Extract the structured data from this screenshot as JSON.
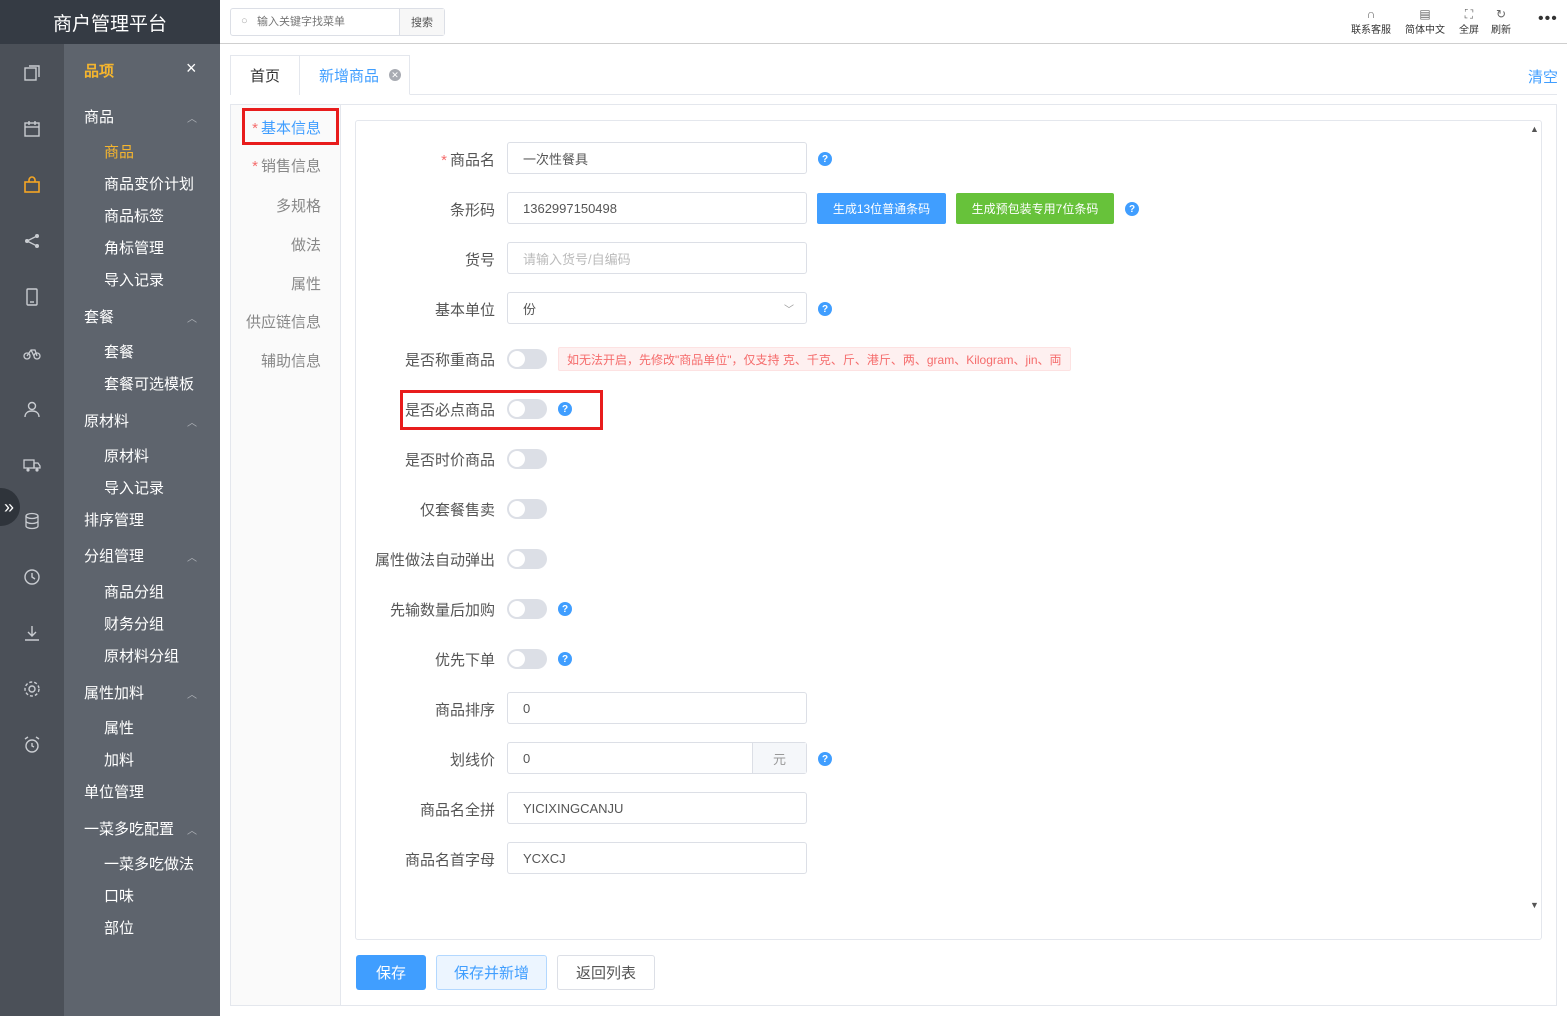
{
  "app": {
    "title": "商户管理平台"
  },
  "rail": {
    "icons": [
      "pages-icon",
      "calendar-icon",
      "bag-icon",
      "share-icon",
      "tablet-icon",
      "bike-icon",
      "user-icon",
      "truck-icon",
      "database-icon",
      "clock-icon",
      "download-icon",
      "settings-icon",
      "alarm-icon"
    ],
    "active_icon": "bag-icon",
    "toggle_icon": "»"
  },
  "menu": {
    "heading": "品项",
    "close": "×",
    "groups": [
      {
        "label": "商品",
        "items": [
          "商品",
          "商品变价计划",
          "商品标签",
          "角标管理",
          "导入记录"
        ]
      },
      {
        "label": "套餐",
        "items": [
          "套餐",
          "套餐可选模板"
        ]
      },
      {
        "label": "原材料",
        "items": [
          "原材料",
          "导入记录"
        ]
      },
      {
        "label": "排序管理",
        "items": []
      },
      {
        "label": "分组管理",
        "items": [
          "商品分组",
          "财务分组",
          "原材料分组"
        ]
      },
      {
        "label": "属性加料",
        "items": [
          "属性",
          "加料"
        ]
      },
      {
        "label": "单位管理",
        "items": []
      },
      {
        "label": "一菜多吃配置",
        "items": [
          "一菜多吃做法",
          "口味",
          "部位"
        ]
      }
    ],
    "active_item": "商品"
  },
  "topbar": {
    "search_placeholder": "输入关键字找菜单",
    "search_button": "搜索",
    "tools": [
      "联系客服",
      "简体中文",
      "全屏",
      "刷新"
    ],
    "more": "•••"
  },
  "tabs": {
    "home": "首页",
    "add": "新增商品",
    "clear": "清空"
  },
  "sidenav": {
    "items": [
      {
        "label": "基本信息",
        "required": true
      },
      {
        "label": "销售信息",
        "required": true
      },
      {
        "label": "多规格",
        "required": false
      },
      {
        "label": "做法",
        "required": false
      },
      {
        "label": "属性",
        "required": false
      },
      {
        "label": "供应链信息",
        "required": false
      },
      {
        "label": "辅助信息",
        "required": false
      }
    ],
    "active": "基本信息"
  },
  "form": {
    "name_label": "商品名",
    "name_value": "一次性餐具",
    "barcode_label": "条形码",
    "barcode_value": "1362997150498",
    "gen13_button": "生成13位普通条码",
    "gen7_button": "生成预包装专用7位条码",
    "sku_label": "货号",
    "sku_placeholder": "请输入货号/自编码",
    "unit_label": "基本单位",
    "unit_value": "份",
    "weigh_label": "是否称重商品",
    "weigh_warning": "如无法开启，先修改\"商品单位\"，仅支持 克、千克、斤、港斤、两、gram、Kilogram、jin、両",
    "required_label": "是否必点商品",
    "timeprice_label": "是否时价商品",
    "combo_only_label": "仅套餐售卖",
    "attr_popup_label": "属性做法自动弹出",
    "qty_first_label": "先输数量后加购",
    "priority_label": "优先下单",
    "sort_label": "商品排序",
    "sort_value": "0",
    "list_price_label": "划线价",
    "list_price_value": "0",
    "list_price_unit": "元",
    "pinyin_label": "商品名全拼",
    "pinyin_value": "YICIXINGCANJU",
    "initials_label": "商品名首字母",
    "initials_value": "YCXCJ",
    "toggles": {
      "weigh": false,
      "required": false,
      "timeprice": false,
      "combo_only": false,
      "attr_popup": false,
      "qty_first": false,
      "priority": false
    }
  },
  "actions": {
    "save": "保存",
    "save_new": "保存并新增",
    "back": "返回列表"
  }
}
